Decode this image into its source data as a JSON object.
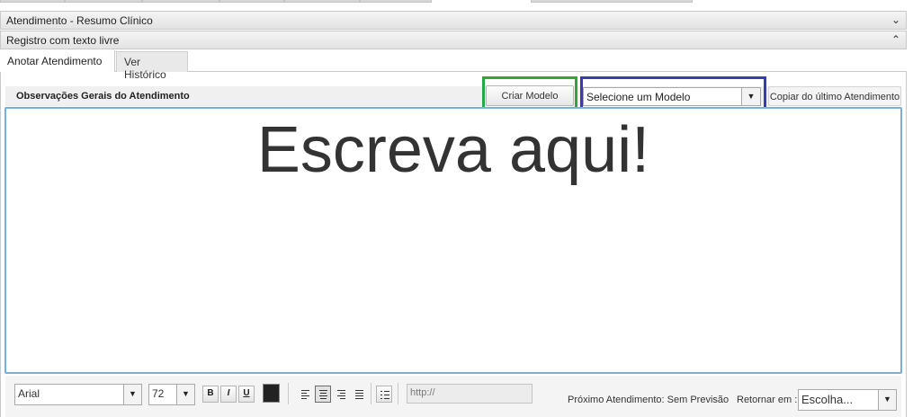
{
  "panels": {
    "resumo_title": "Atendimento - Resumo Clínico",
    "registro_title": "Registro com texto livre",
    "expand_icon": "chevron-down-icon",
    "collapse_icon": "chevron-up-icon"
  },
  "tabs": {
    "anotar": "Anotar Atendimento",
    "historico": "Ver Histórico"
  },
  "observacoes": {
    "title": "Observações Gerais do Atendimento",
    "criar_modelo": "Criar Modelo",
    "model_select_value": "Selecione um Modelo",
    "copiar": "Copiar do último Atendimento"
  },
  "editor": {
    "content": "Escreva aqui!"
  },
  "toolbar": {
    "font_value": "Arial",
    "size_value": "72",
    "bold": "B",
    "italic": "I",
    "underline": "U",
    "link_value": "http://",
    "proximo": "Próximo Atendimento: Sem Previsão",
    "retornar_label": "Retornar em :",
    "retornar_value": "Escolha..."
  },
  "colors": {
    "highlight_green": "#2ca642",
    "highlight_blue": "#3a3ab5",
    "editor_border": "#7ab0d8",
    "text_color_swatch": "#222222"
  }
}
